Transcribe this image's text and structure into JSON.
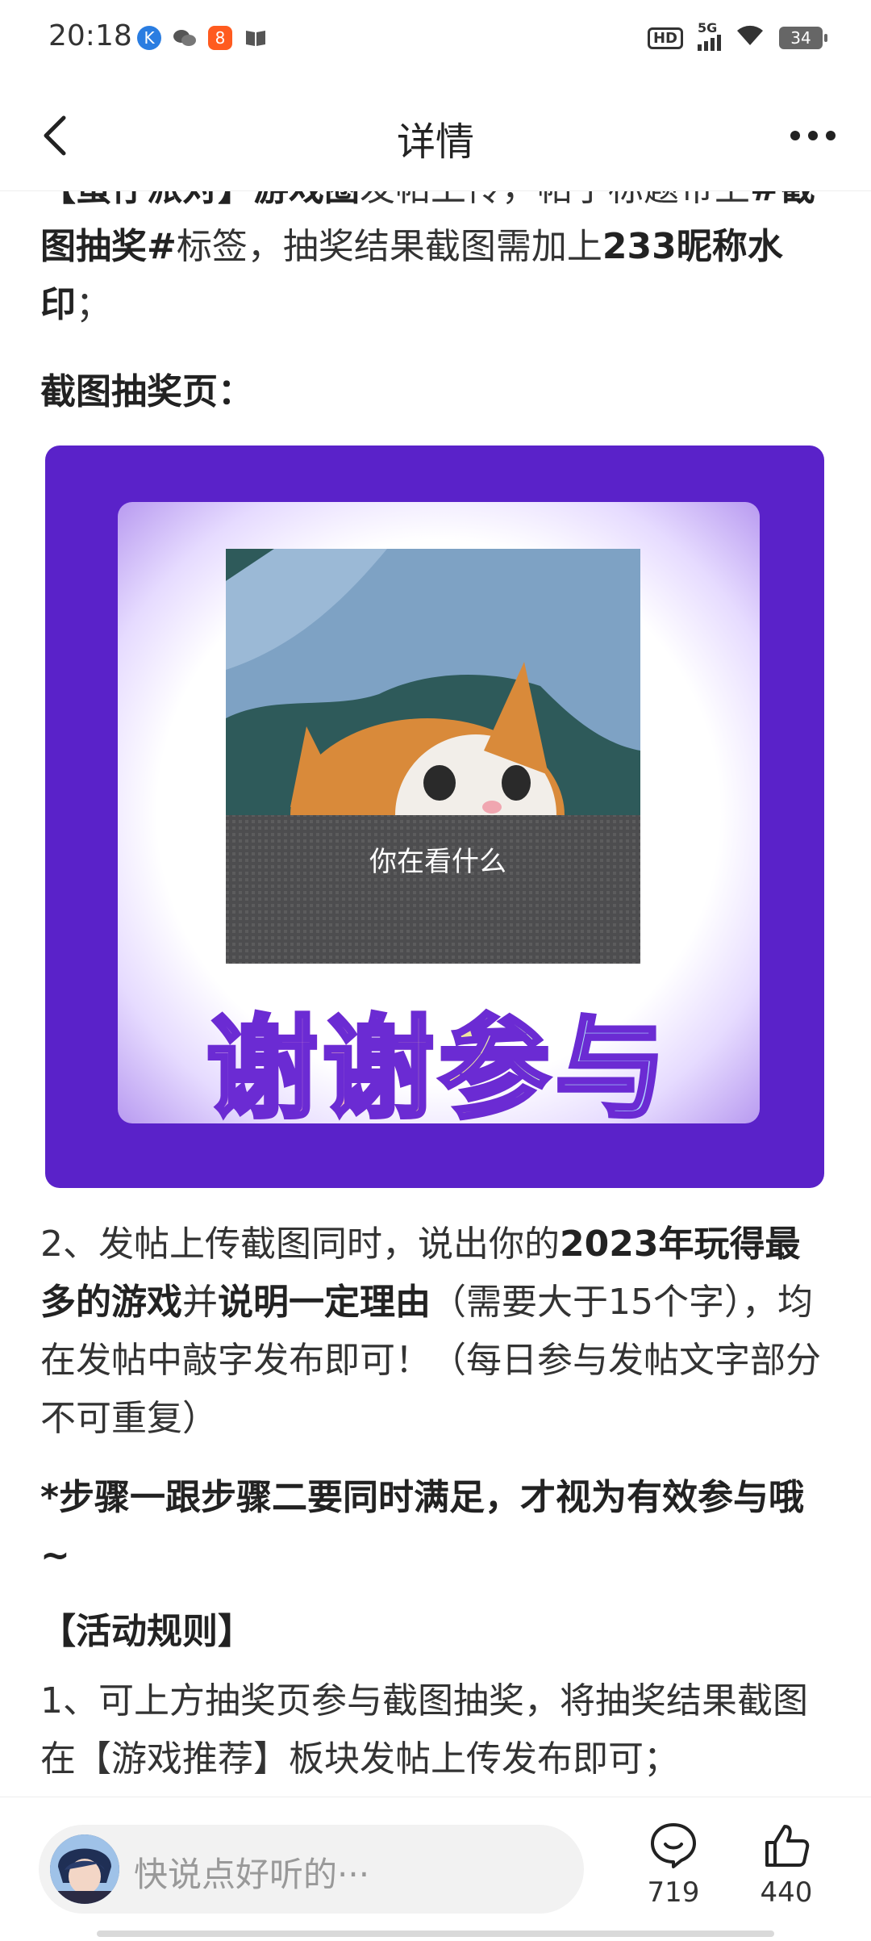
{
  "status_bar": {
    "time": "20:18",
    "hd": "HD",
    "network": "5G",
    "battery": "34",
    "icons": [
      "app-k-icon",
      "wechat-icon",
      "app-badge-icon",
      "book-icon"
    ]
  },
  "header": {
    "title": "详情",
    "back_icon": "chevron-left-icon",
    "more_icon": "more-dots-icon"
  },
  "content": {
    "p0_a": "【蛋仔派对】游戏圈",
    "p0_b": "发帖上传，帖子标题带上",
    "p0_c": "#截图抽奖#",
    "p0_d": "标签，抽奖结果截图需加上",
    "p0_e": "233昵称水印",
    "p0_f": "；",
    "lottery_heading": "截图抽奖页：",
    "promo_caption": "你在看什么",
    "promo_thanks": "谢谢参与",
    "p2_a": "2、发帖上传截图同时，说出你的",
    "p2_b": "2023年玩得最多的游戏",
    "p2_c": "并",
    "p2_d": "说明一定理由",
    "p2_e": "（需要大于15个字），均在发帖中敲字发布即可！（每日参与发帖文字部分不可重复）",
    "note": "*步骤一跟步骤二要同时满足，才视为有效参与哦~",
    "rules_heading": "【活动规则】",
    "rule1": "1、可上方抽奖页参与截图抽奖，将抽奖结果截图在【游戏推荐】板块发帖上传发布即可；"
  },
  "bottom_bar": {
    "placeholder": "快说点好听的···",
    "comment_count": "719",
    "like_count": "440"
  }
}
